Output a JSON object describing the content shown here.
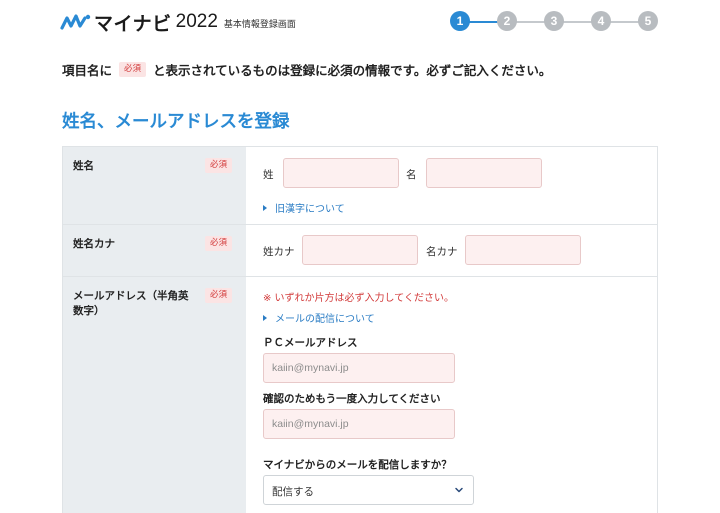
{
  "header": {
    "logo_name": "マイナビ",
    "logo_year": "2022",
    "logo_subtitle": "基本情報登録画面",
    "steps": [
      {
        "label": "1",
        "active": true
      },
      {
        "label": "2",
        "active": false
      },
      {
        "label": "3",
        "active": false
      },
      {
        "label": "4",
        "active": false
      },
      {
        "label": "5",
        "active": false
      }
    ]
  },
  "intro": {
    "before": "項目名に",
    "badge": "必須",
    "after": "と表示されているものは登録に必須の情報です。必ずご記入ください。"
  },
  "section_title": "姓名、メールアドレスを登録",
  "required_badge": "必須",
  "rows": {
    "name": {
      "label": "姓名",
      "sei_label": "姓",
      "mei_label": "名",
      "sei_value": "",
      "mei_value": "",
      "link": "旧漢字について"
    },
    "kana": {
      "label": "姓名カナ",
      "sei_label": "姓カナ",
      "mei_label": "名カナ",
      "sei_value": "",
      "mei_value": ""
    },
    "email": {
      "label": "メールアドレス（半角英数字）",
      "notice": "※ いずれか片方は必ず入力してください。",
      "link": "メールの配信について",
      "pc_label": "ＰＣメールアドレス",
      "pc_placeholder": "kaiin@mynavi.jp",
      "confirm_label": "確認のためもう一度入力してください",
      "confirm_placeholder": "kaiin@mynavi.jp",
      "delivery_question": "マイナビからのメールを配信しますか？",
      "delivery_value": "配信する"
    }
  },
  "colors": {
    "accent": "#2a8ad4",
    "required": "#d23a3a",
    "input_bg": "#fdf0f0"
  }
}
